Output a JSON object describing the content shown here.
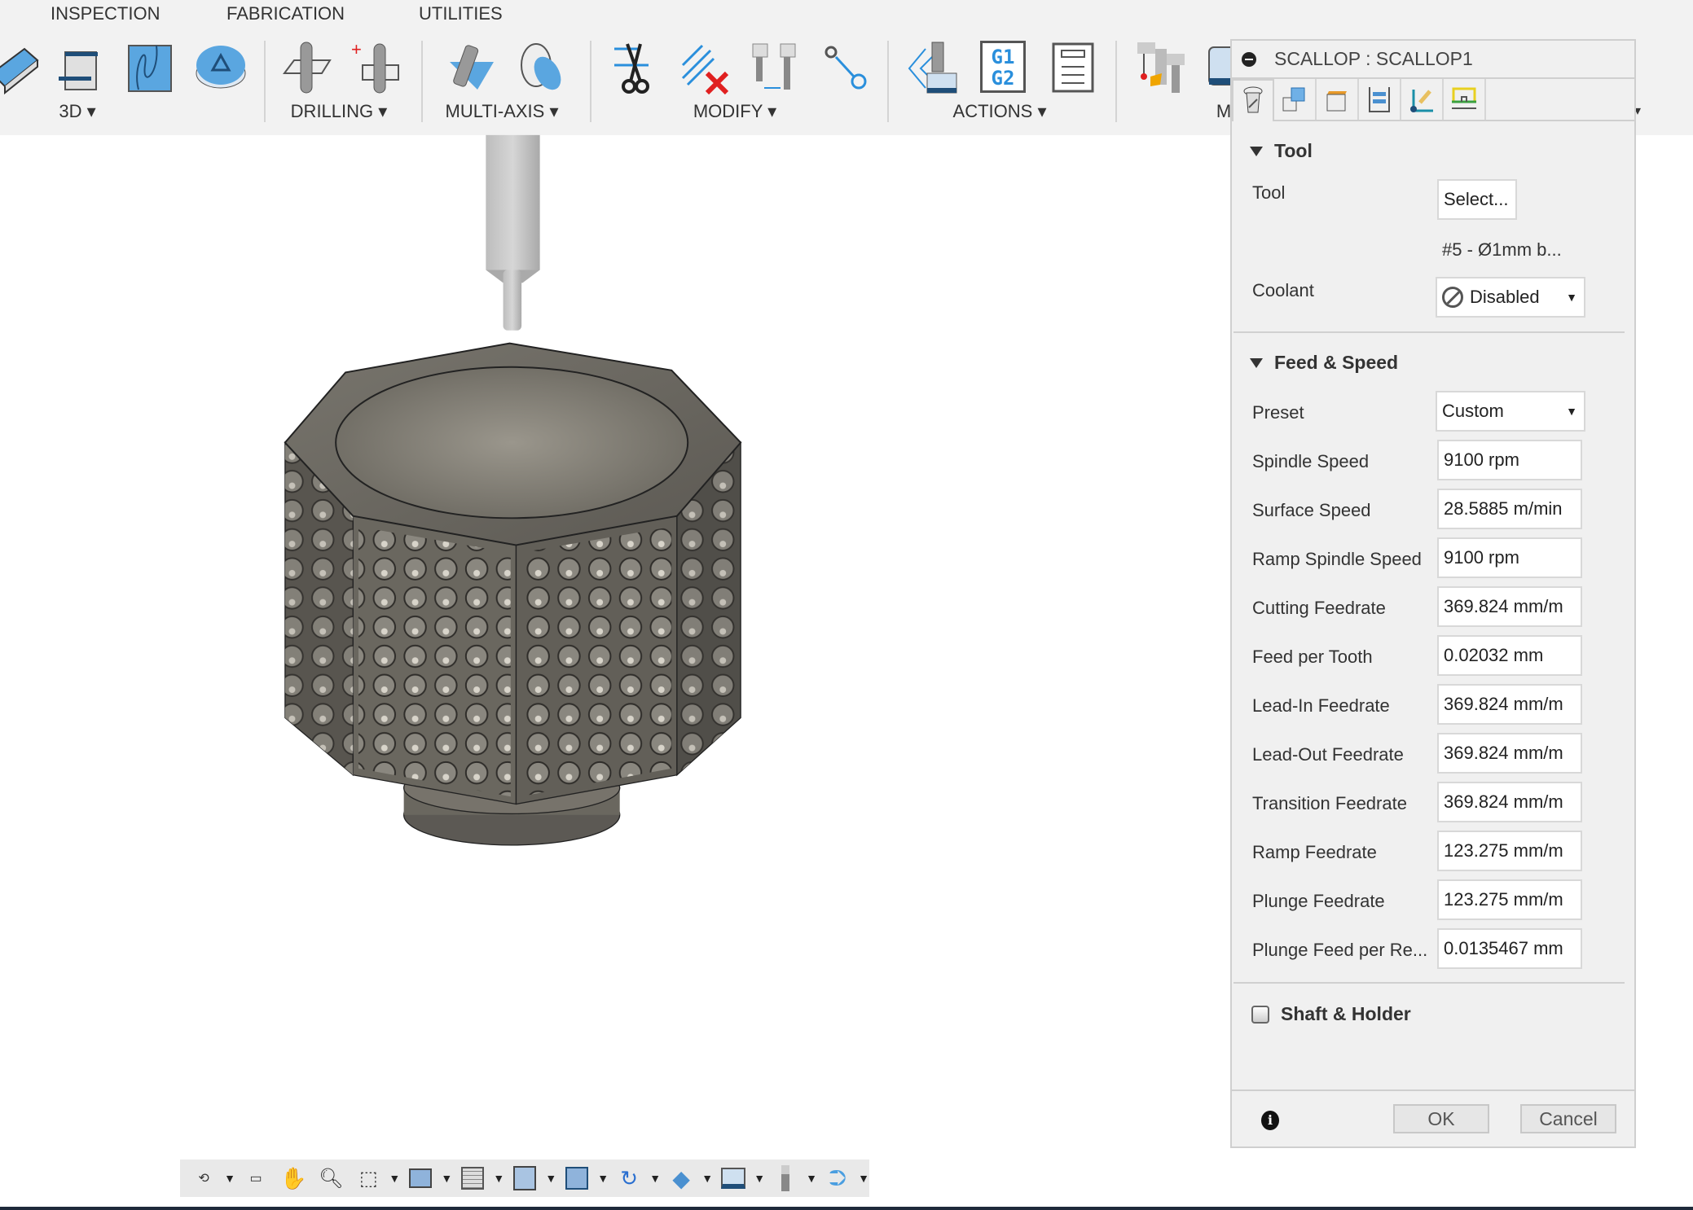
{
  "toolbar": {
    "tabs": [
      "INSPECTION",
      "FABRICATION",
      "UTILITIES"
    ],
    "groups": {
      "g3d": "3D",
      "drilling": "DRILLING",
      "multiaxis": "MULTI-AXIS",
      "modify": "MODIFY",
      "actions": "ACTIONS",
      "manage_partial": "M"
    },
    "dropdown_arrow": "▾",
    "gcode_icon_text": "G1\nG2"
  },
  "dialog": {
    "title": "SCALLOP : SCALLOP1",
    "tabs": [
      "tool-tab",
      "geometry-tab",
      "heights-tab",
      "passes-tab",
      "linking-tab",
      "simulation-tab"
    ],
    "tool_section": {
      "header": "Tool",
      "tool_label": "Tool",
      "tool_button": "Select...",
      "tool_name": "#5 - Ø1mm b...",
      "coolant_label": "Coolant",
      "coolant_value": "Disabled"
    },
    "feed_section": {
      "header": "Feed & Speed",
      "preset_label": "Preset",
      "preset_value": "Custom",
      "fields": [
        {
          "label": "Spindle Speed",
          "value": "9100 rpm"
        },
        {
          "label": "Surface Speed",
          "value": "28.5885 m/min"
        },
        {
          "label": "Ramp Spindle Speed",
          "value": "9100 rpm"
        },
        {
          "label": "Cutting Feedrate",
          "value": "369.824 mm/m"
        },
        {
          "label": "Feed per Tooth",
          "value": "0.02032 mm"
        },
        {
          "label": "Lead-In Feedrate",
          "value": "369.824 mm/m"
        },
        {
          "label": "Lead-Out Feedrate",
          "value": "369.824 mm/m"
        },
        {
          "label": "Transition Feedrate",
          "value": "369.824 mm/m"
        },
        {
          "label": "Ramp Feedrate",
          "value": "123.275 mm/m"
        },
        {
          "label": "Plunge Feedrate",
          "value": "123.275 mm/m"
        },
        {
          "label": "Plunge Feed per Re...",
          "value": "0.0135467 mm"
        }
      ]
    },
    "shaft_section": {
      "label": "Shaft & Holder",
      "checked": false
    },
    "ok": "OK",
    "cancel": "Cancel"
  },
  "colors": {
    "accent": "#2a8fdc",
    "panel_bg": "#f0f0f0",
    "toolbar_bg": "#f2f2f2",
    "model": "#6e6b64"
  }
}
